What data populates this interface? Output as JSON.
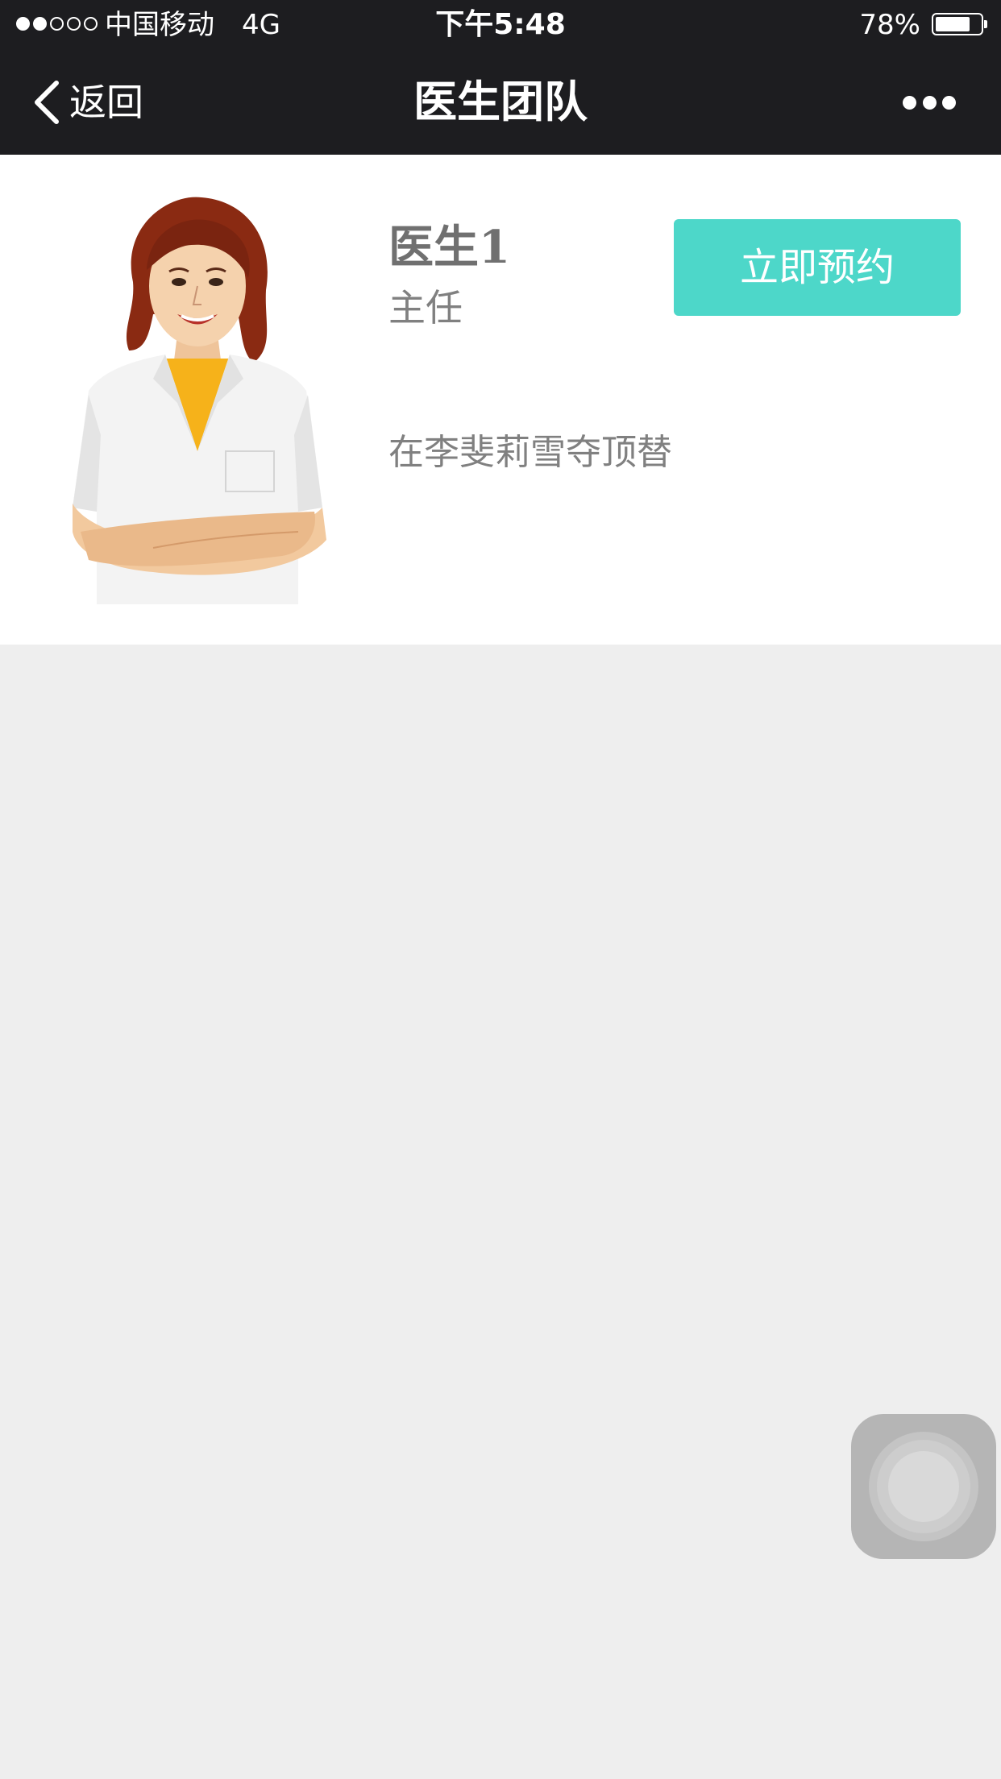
{
  "status_bar": {
    "signal_dots": [
      true,
      true,
      false,
      false,
      false
    ],
    "carrier": "中国移动",
    "network": "4G",
    "time": "下午5:48",
    "battery_percent": "78%",
    "battery_level": 0.78
  },
  "nav": {
    "back_icon": "chevron-left-icon",
    "back_label": "返回",
    "title": "医生团队",
    "more_icon": "more-dots-icon"
  },
  "doctor": {
    "avatar_icon": "doctor-illustration",
    "name": "医生1",
    "title": "主任",
    "description": "在李斐莉雪夺顶替",
    "book_label": "立即预约"
  },
  "colors": {
    "bar_background": "#1d1d20",
    "accent": "#4dd7c9",
    "page_background": "#eeeeee",
    "card_background": "#ffffff",
    "secondary_text": "#808080"
  },
  "assistive_touch_icon": "assistive-touch-icon"
}
